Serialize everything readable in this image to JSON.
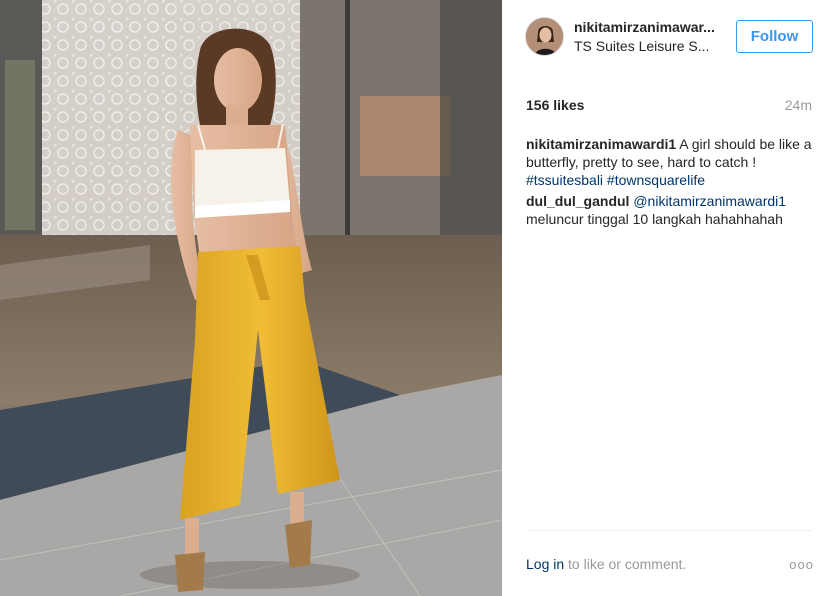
{
  "post": {
    "photo_icon": "photo-of-woman-in-white-crop-top-and-yellow-culottes",
    "header": {
      "avatar_icon": "profile-avatar",
      "username": "nikitamirzanimawar...",
      "location": "TS Suites Leisure S...",
      "follow_label": "Follow"
    },
    "likes": "156 likes",
    "time": "24m",
    "comments": [
      {
        "username": "nikitamirzanimawardi1",
        "text": " A girl should be like a butterfly, pretty to see, hard to catch ! ",
        "tags": "#tssuitesbali #townsquarelife"
      },
      {
        "username": "dul_dul_gandul",
        "mention": " @nikitamirzanimawardi1",
        "text": " meluncur tinggal 10 langkah hahahhahah"
      }
    ],
    "footer": {
      "login_link": "Log in",
      "login_suffix": " to like or comment."
    },
    "more_icon": "more-options-icon",
    "more_glyph": "ooo"
  },
  "colors": {
    "link_blue": "#3897f0",
    "tag_navy": "#003569",
    "muted": "#999999",
    "text": "#262626"
  }
}
